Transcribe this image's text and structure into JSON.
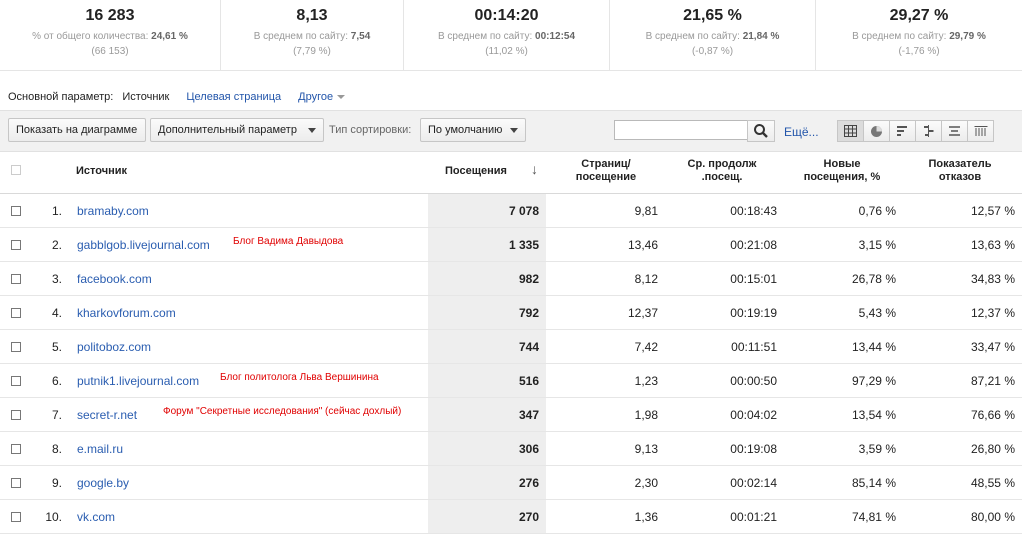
{
  "summary": [
    {
      "value": "16 283",
      "label": "% от общего количества:",
      "label_val": "24,61 %",
      "sub": "(66 153)"
    },
    {
      "value": "8,13",
      "label": "В среднем по сайту:",
      "label_val": "7,54",
      "sub": "(7,79 %)"
    },
    {
      "value": "00:14:20",
      "label": "В среднем по сайту:",
      "label_val": "00:12:54",
      "sub": "(11,02 %)"
    },
    {
      "value": "21,65 %",
      "label": "В среднем по сайту:",
      "label_val": "21,84 %",
      "sub": "(-0,87 %)"
    },
    {
      "value": "29,27 %",
      "label": "В среднем по сайту:",
      "label_val": "29,79 %",
      "sub": "(-1,76 %)"
    }
  ],
  "dimension": {
    "label": "Основной параметр:",
    "active": "Источник",
    "landing": "Целевая страница",
    "other": "Другое"
  },
  "toolbar": {
    "show_chart": "Показать на диаграмме",
    "secondary": "Дополнительный параметр",
    "sort_label": "Тип сортировки:",
    "sort_value": "По умолчанию",
    "search_value": "",
    "more": "Ещё..."
  },
  "table": {
    "headers": {
      "source": "Источник",
      "visits": "Посещения",
      "pages_1": "Страниц/",
      "pages_2": "посещение",
      "dur_1": "Ср. продолж",
      "dur_2": ".посещ.",
      "new_1": "Новые",
      "new_2": "посещения, %",
      "bounce_1": "Показатель",
      "bounce_2": "отказов"
    },
    "sort_arrow": "↓",
    "rows": [
      {
        "idx": "1.",
        "source": "bramaby.com",
        "note": "",
        "visits": "7 078",
        "pages": "9,81",
        "dur": "00:18:43",
        "newv": "0,76 %",
        "bounce": "12,57 %"
      },
      {
        "idx": "2.",
        "source": "gabblgob.livejournal.com",
        "note": "Блог Вадима Давыдова",
        "visits": "1 335",
        "pages": "13,46",
        "dur": "00:21:08",
        "newv": "3,15 %",
        "bounce": "13,63 %"
      },
      {
        "idx": "3.",
        "source": "facebook.com",
        "note": "",
        "visits": "982",
        "pages": "8,12",
        "dur": "00:15:01",
        "newv": "26,78 %",
        "bounce": "34,83 %"
      },
      {
        "idx": "4.",
        "source": "kharkovforum.com",
        "note": "",
        "visits": "792",
        "pages": "12,37",
        "dur": "00:19:19",
        "newv": "5,43 %",
        "bounce": "12,37 %"
      },
      {
        "idx": "5.",
        "source": "politoboz.com",
        "note": "",
        "visits": "744",
        "pages": "7,42",
        "dur": "00:11:51",
        "newv": "13,44 %",
        "bounce": "33,47 %"
      },
      {
        "idx": "6.",
        "source": "putnik1.livejournal.com",
        "note": "Блог политолога Льва Вершинина",
        "visits": "516",
        "pages": "1,23",
        "dur": "00:00:50",
        "newv": "97,29 %",
        "bounce": "87,21 %"
      },
      {
        "idx": "7.",
        "source": "secret-r.net",
        "note": "Форум \"Секретные исследования\" (сейчас дохлый)",
        "visits": "347",
        "pages": "1,98",
        "dur": "00:04:02",
        "newv": "13,54 %",
        "bounce": "76,66 %"
      },
      {
        "idx": "8.",
        "source": "e.mail.ru",
        "note": "",
        "visits": "306",
        "pages": "9,13",
        "dur": "00:19:08",
        "newv": "3,59 %",
        "bounce": "26,80 %"
      },
      {
        "idx": "9.",
        "source": "google.by",
        "note": "",
        "visits": "276",
        "pages": "2,30",
        "dur": "00:02:14",
        "newv": "85,14 %",
        "bounce": "48,55 %"
      },
      {
        "idx": "10.",
        "source": "vk.com",
        "note": "",
        "visits": "270",
        "pages": "1,36",
        "dur": "00:01:21",
        "newv": "74,81 %",
        "bounce": "80,00 %"
      }
    ]
  }
}
